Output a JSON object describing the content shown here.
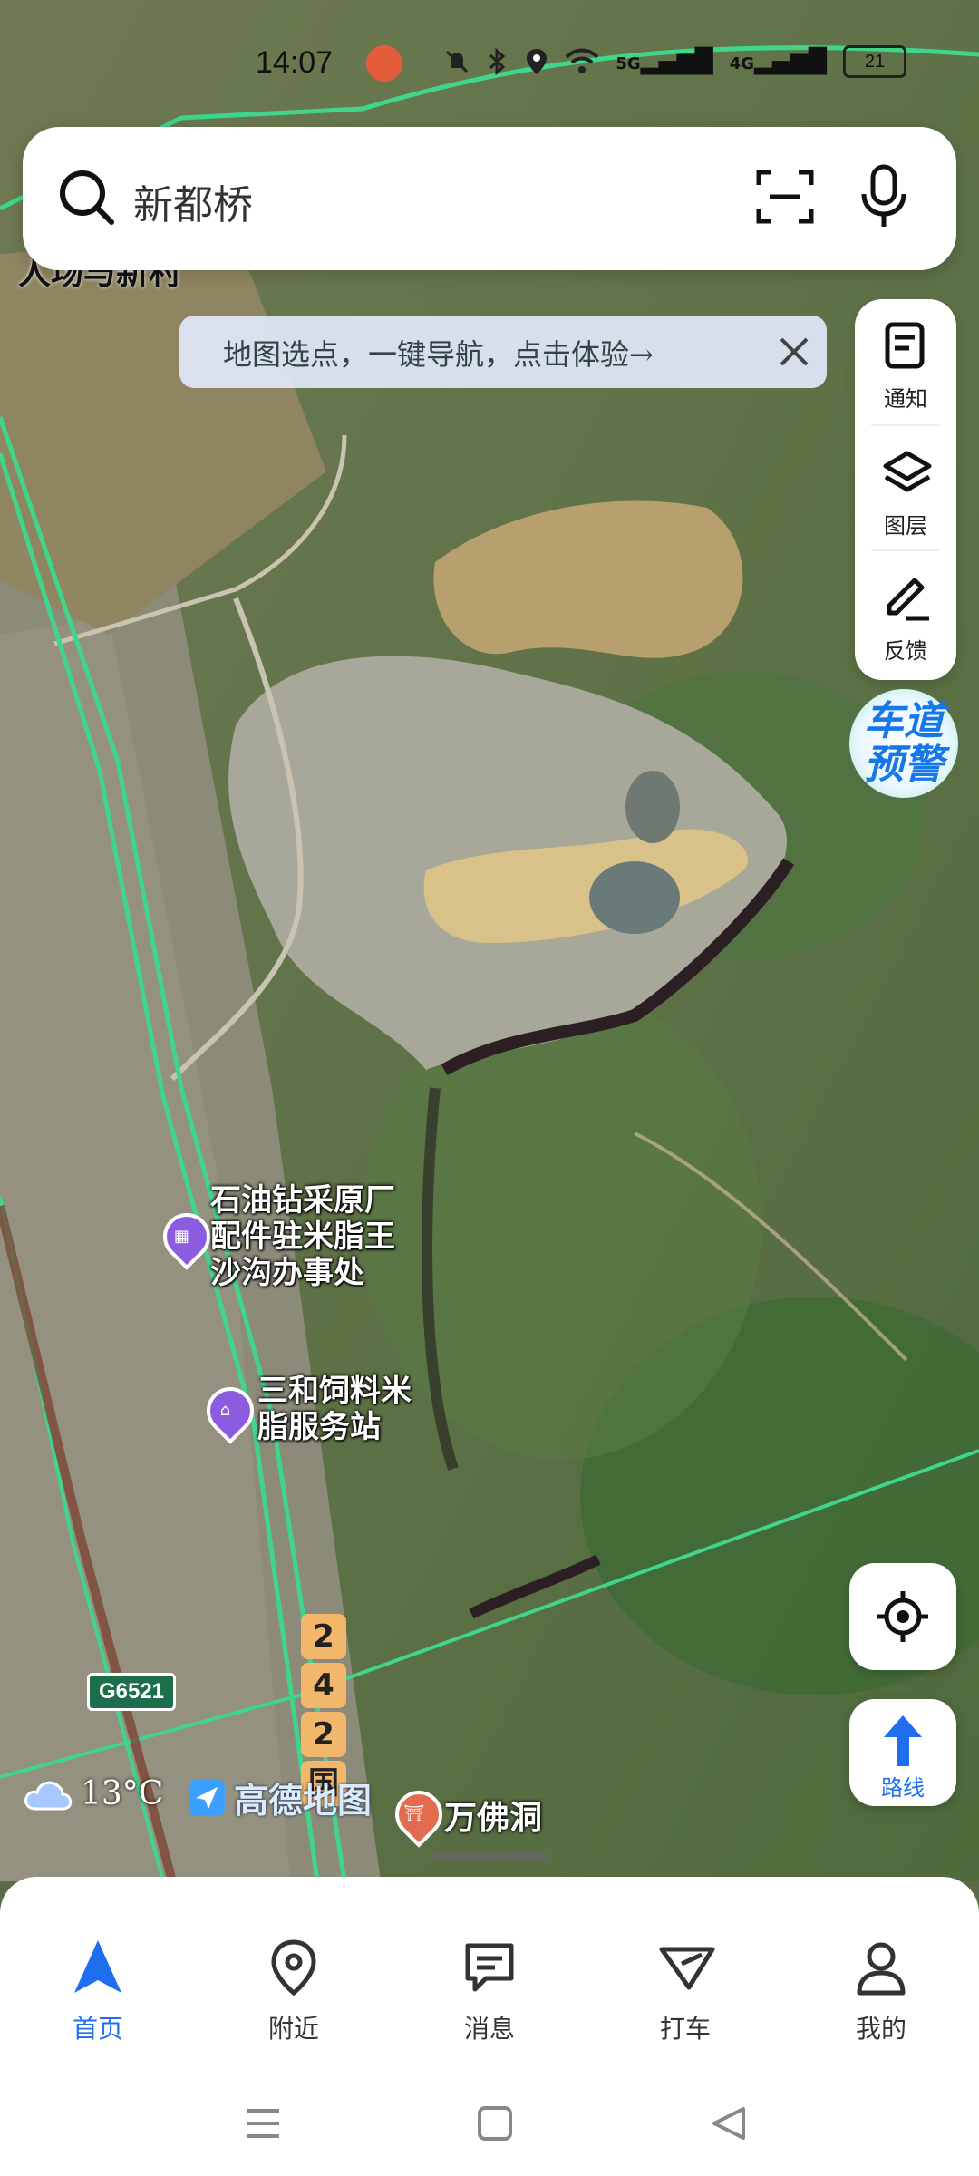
{
  "status_bar": {
    "time": "14:07",
    "network_labels": [
      "5G",
      "4G"
    ],
    "battery": "21",
    "icons": [
      "mute-icon",
      "bluetooth-icon",
      "location-icon",
      "wifi-icon",
      "signal-5g-icon",
      "signal-4g-icon",
      "battery-icon"
    ]
  },
  "search": {
    "text": "新都桥"
  },
  "tip_banner": {
    "text": "地图选点，一键导航，点击体验→"
  },
  "side_tools": {
    "notify": "通知",
    "layers": "图层",
    "feedback": "反馈"
  },
  "lane_warning": {
    "line1": "车道",
    "line2": "预警"
  },
  "map": {
    "top_partial_label": "人场与新村",
    "pois": [
      {
        "name": "石油钻采原厂\n配件驻米脂王\n沙沟办事处",
        "line1": "石油钻采原厂",
        "line2": "配件驻米脂王",
        "line3": "沙沟办事处",
        "icon": "building-icon"
      },
      {
        "name": "三和饲料米\n脂服务站",
        "line1": "三和饲料米",
        "line2": "脂服务站",
        "icon": "shop-icon"
      },
      {
        "name": "万佛洞",
        "icon": "temple-icon"
      }
    ],
    "road_shield": "G6521",
    "road_242": [
      "2",
      "4",
      "2",
      "国"
    ]
  },
  "weather": {
    "temp": "13°C",
    "icon": "cloud-icon"
  },
  "logo": {
    "text": "高德地图",
    "icon": "amap-logo-icon"
  },
  "buttons": {
    "route_label": "路线"
  },
  "tabs": [
    {
      "label": "首页",
      "icon": "home-nav-icon",
      "active": true
    },
    {
      "label": "附近",
      "icon": "nearby-pin-icon",
      "active": false
    },
    {
      "label": "消息",
      "icon": "message-icon",
      "active": false
    },
    {
      "label": "打车",
      "icon": "taxi-icon",
      "active": false
    },
    {
      "label": "我的",
      "icon": "profile-icon",
      "active": false
    }
  ],
  "colors": {
    "accent": "#1f6ef0",
    "road_green": "#3fd68c",
    "poi_purple": "#8c5ce0"
  }
}
